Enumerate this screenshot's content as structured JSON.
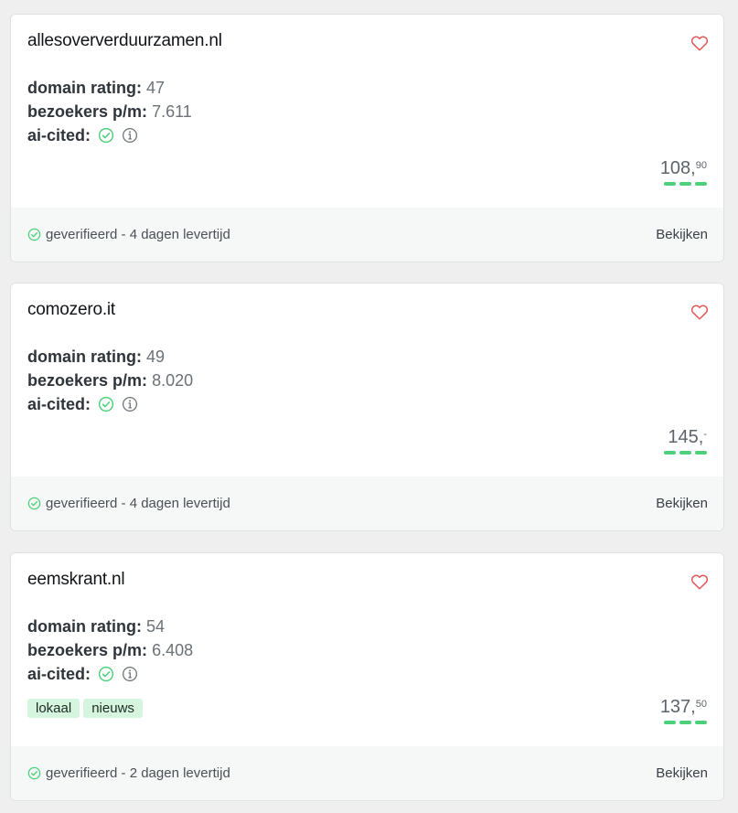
{
  "listings": [
    {
      "domain": "allesoververduurzamen.nl",
      "domain_rating_label": "domain rating:",
      "domain_rating": "47",
      "visitors_label": "bezoekers p/m:",
      "visitors": "7.611",
      "ai_cited_label": "ai-cited:",
      "price_main": "108,",
      "price_cents": "90",
      "tags": [],
      "footer_status": "geverifieerd - 4 dagen levertijd",
      "view_label": "Bekijken"
    },
    {
      "domain": "comozero.it",
      "domain_rating_label": "domain rating:",
      "domain_rating": "49",
      "visitors_label": "bezoekers p/m:",
      "visitors": "8.020",
      "ai_cited_label": "ai-cited:",
      "price_main": "145,",
      "price_cents": "-",
      "tags": [],
      "footer_status": "geverifieerd - 4 dagen levertijd",
      "view_label": "Bekijken"
    },
    {
      "domain": "eemskrant.nl",
      "domain_rating_label": "domain rating:",
      "domain_rating": "54",
      "visitors_label": "bezoekers p/m:",
      "visitors": "6.408",
      "ai_cited_label": "ai-cited:",
      "price_main": "137,",
      "price_cents": "50",
      "tags": [
        "lokaal",
        "nieuws"
      ],
      "footer_status": "geverifieerd - 2 dagen levertijd",
      "view_label": "Bekijken"
    }
  ],
  "icons": {
    "favorite": "heart-outline-icon",
    "ai_cited": "check-circle-icon",
    "info": "info-circle-icon",
    "verified": "check-circle-icon"
  },
  "colors": {
    "accent_green": "#4cd07a",
    "heart_red": "#e05555",
    "tag_background": "#d5f5df"
  }
}
